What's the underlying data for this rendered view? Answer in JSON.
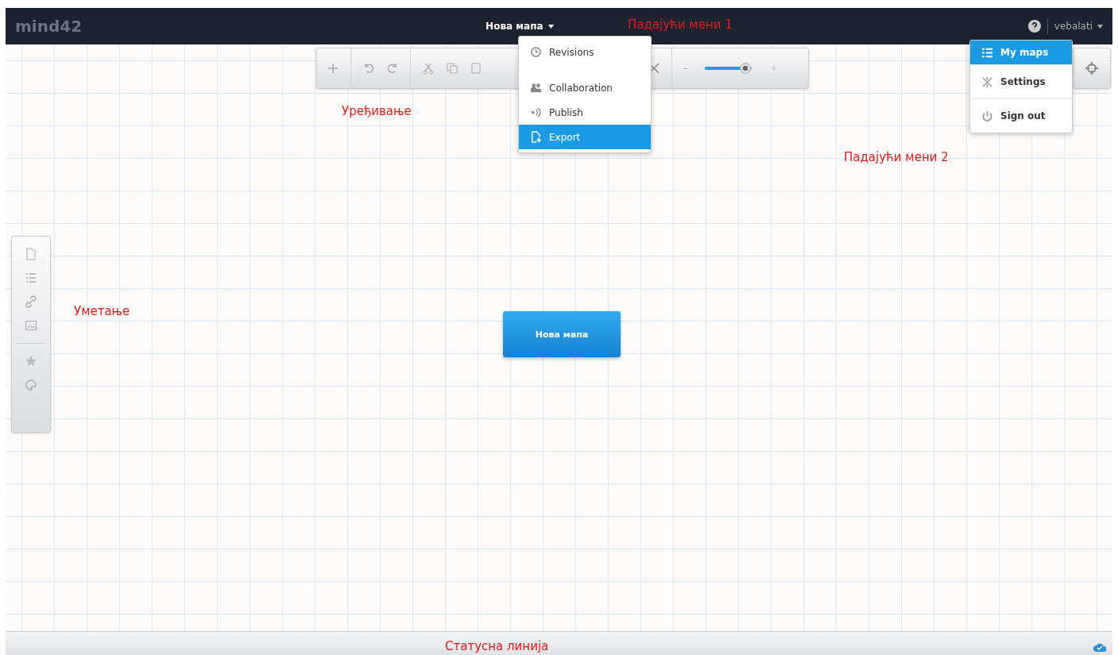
{
  "header": {
    "logo": "mind42",
    "map_title": "Нова мапа",
    "user": "vebalati"
  },
  "edit_toolbar": {
    "zoom": {
      "level": 0.85
    }
  },
  "map_menu": {
    "items": [
      {
        "label": "Revisions",
        "selected": false
      },
      {
        "label": "Collaboration",
        "selected": false
      },
      {
        "label": "Publish",
        "selected": false
      },
      {
        "label": "Export",
        "selected": true
      }
    ]
  },
  "user_menu": {
    "items": [
      {
        "label": "My maps",
        "selected": true
      },
      {
        "label": "Settings",
        "selected": false
      },
      {
        "label": "Sign out",
        "selected": false
      }
    ]
  },
  "root_node": {
    "label": "Нова мапа"
  },
  "annotations": [
    {
      "label": "Падајући мени 1"
    },
    {
      "label": "Уређивање"
    },
    {
      "label": "Падајући мени 2"
    },
    {
      "label": "Уметање"
    },
    {
      "label": "Статусна линија"
    }
  ]
}
